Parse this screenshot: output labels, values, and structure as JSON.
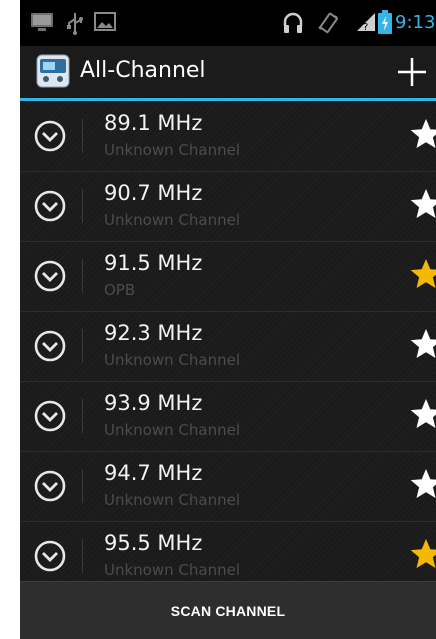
{
  "status_bar": {
    "time": "9:13",
    "icons": [
      "monitor-icon",
      "usb-icon",
      "image-icon",
      "headphones-icon",
      "vibrate-icon",
      "signal-icon",
      "battery-charging-icon"
    ]
  },
  "action_bar": {
    "title": "All-Channel",
    "add_icon": "plus-icon"
  },
  "channels": [
    {
      "freq": "89.1 MHz",
      "name": "Unknown Channel",
      "favorite": false
    },
    {
      "freq": "90.7 MHz",
      "name": "Unknown Channel",
      "favorite": false
    },
    {
      "freq": "91.5 MHz",
      "name": "OPB",
      "favorite": true
    },
    {
      "freq": "92.3 MHz",
      "name": "Unknown Channel",
      "favorite": false
    },
    {
      "freq": "93.9 MHz",
      "name": "Unknown Channel",
      "favorite": false
    },
    {
      "freq": "94.7 MHz",
      "name": "Unknown Channel",
      "favorite": false
    },
    {
      "freq": "95.5 MHz",
      "name": "Unknown Channel",
      "favorite": true
    }
  ],
  "bottom": {
    "scan_label": "SCAN CHANNEL"
  },
  "colors": {
    "accent": "#33b5e5",
    "favorite_star": "#f5b800",
    "star_off": "#ffffff"
  }
}
